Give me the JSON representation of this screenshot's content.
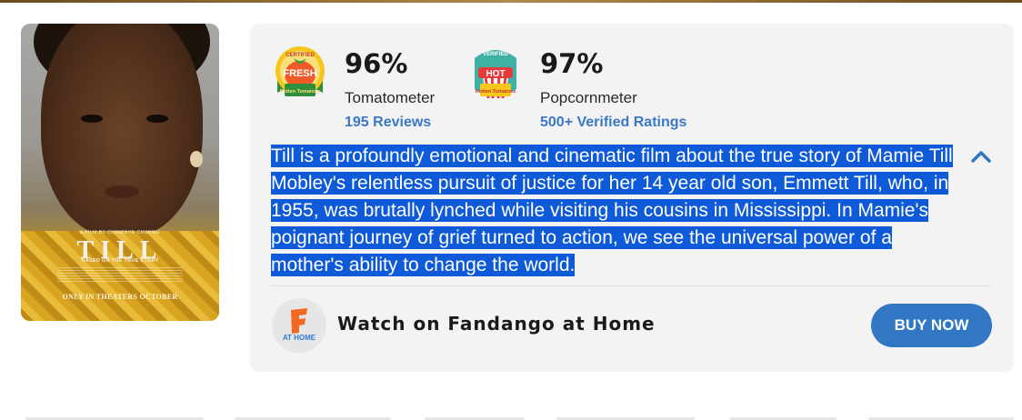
{
  "poster": {
    "title": "TILL",
    "credit_top": "A FILM BY CHINONYE CHUKWU",
    "tagline": "BASED ON THE TRUE STORY",
    "release_note": "ONLY IN THEATERS OCTOBER"
  },
  "scores": {
    "tomatometer": {
      "badge_top": "CERTIFIED",
      "badge_main": "FRESH",
      "badge_brand": "Rotten Tomatoes",
      "value": "96%",
      "label": "Tomatometer",
      "link": "195 Reviews"
    },
    "popcornmeter": {
      "badge_top": "VERIFIED",
      "badge_main": "HOT",
      "badge_brand": "Rotten Tomatoes",
      "value": "97%",
      "label": "Popcornmeter",
      "link": "500+ Verified Ratings"
    }
  },
  "synopsis": {
    "text": "Till is a profoundly emotional and cinematic film about the true story of Mamie Till Mobley's relentless pursuit of justice for her 14 year old son, Emmett Till, who, in 1955, was brutally lynched while visiting his cousins in Mississippi. In Mamie's poignant journey of grief turned to action, we see the universal power of a mother's ability to change the world.",
    "selected": true
  },
  "watch": {
    "logo_text": "AT HOME",
    "label": "Watch on Fandango at Home",
    "buy_label": "BUY NOW"
  },
  "icons": {
    "collapse": "chevron-up-icon",
    "tomato_badge": "certified-fresh-icon",
    "popcorn_badge": "verified-hot-icon",
    "fandango": "fandango-f-icon"
  },
  "colors": {
    "link": "#3a78c6",
    "button": "#3177c4",
    "selection": "#0f5ad8",
    "card_bg": "#f3f3f3"
  }
}
